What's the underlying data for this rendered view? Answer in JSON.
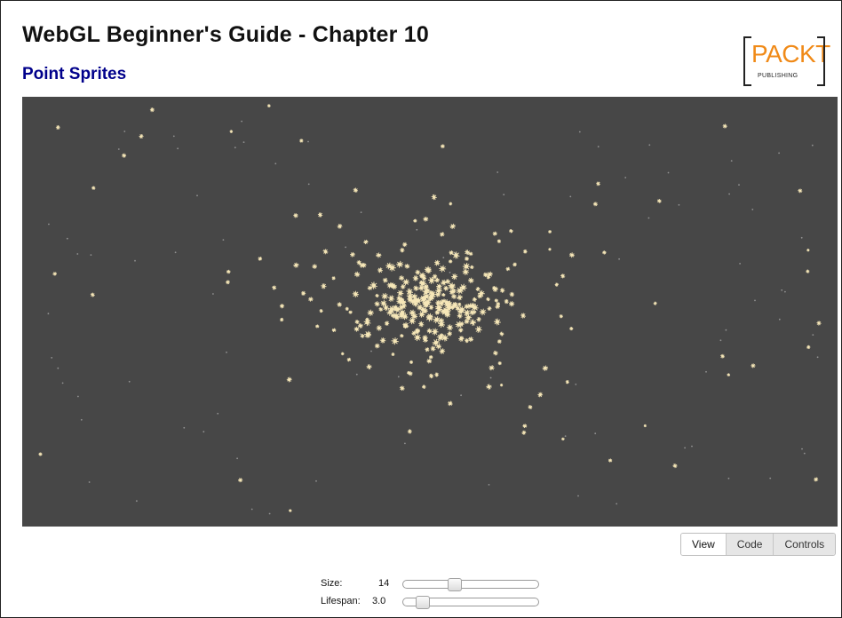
{
  "header": {
    "title": "WebGL Beginner's Guide - Chapter 10",
    "subtitle": "Point Sprites"
  },
  "logo": {
    "brand": "PACKT",
    "tagline": "PUBLISHING",
    "icon": "packt-publishing-logo"
  },
  "viewport": {
    "background": "#474747",
    "sprite_color": "#f6e7b8",
    "icon": "particle-sprite-canvas"
  },
  "tabs": [
    {
      "label": "View",
      "active": true
    },
    {
      "label": "Code",
      "active": false
    },
    {
      "label": "Controls",
      "active": false
    }
  ],
  "controls": {
    "size": {
      "label": "Size:",
      "value": "14",
      "fraction": 0.37
    },
    "lifespan": {
      "label": "Lifespan:",
      "value": "3.0",
      "fraction": 0.1
    }
  },
  "colors": {
    "title": "#111111",
    "subtitle": "#00008b",
    "brand": "#f08a18"
  }
}
